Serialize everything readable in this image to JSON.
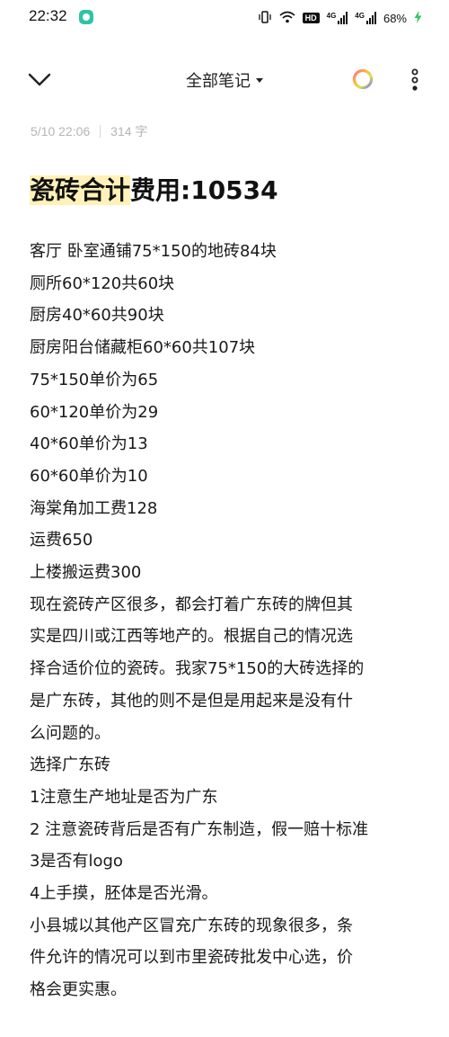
{
  "status_bar": {
    "time": "22:32",
    "hd_label": "HD",
    "signal_label_1": "4G",
    "signal_label_2": "4G",
    "battery": "68%"
  },
  "app_bar": {
    "title": "全部笔记"
  },
  "note": {
    "date": "5/10 22:06",
    "word_count": "314 字",
    "title_highlight": "瓷砖合计",
    "title_rest": "费用:10534",
    "lines": [
      "客厅 卧室通铺75*150的地砖84块",
      "厕所60*120共60块",
      "厨房40*60共90块",
      "厨房阳台储藏柜60*60共107块",
      "75*150单价为65",
      "60*120单价为29",
      "40*60单价为13",
      "60*60单价为10",
      "海棠角加工费128",
      "运费650",
      "上楼搬运费300",
      "现在瓷砖产区很多，都会打着广东砖的牌但其",
      "实是四川或江西等地产的。根据自己的情况选",
      "择合适价位的瓷砖。我家75*150的大砖选择的",
      "是广东砖，其他的则不是但是用起来是没有什",
      "么问题的。",
      "选择广东砖",
      "1注意生产地址是否为广东",
      "2 注意瓷砖背后是否有广东制造，假一赔十标准",
      "3是否有logo",
      "4上手摸，胚体是否光滑。",
      "小县城以其他产区冒充广东砖的现象很多，条",
      "件允许的情况可以到市里瓷砖批发中心选，价",
      "格会更实惠。"
    ]
  },
  "icons": {
    "back": "chevron-down-icon",
    "theme": "color-ring-icon",
    "more": "more-vertical-icon"
  },
  "colors": {
    "highlight": "#fff1b8",
    "meta_text": "#b5b5b5",
    "app_badge": "#2ec4a6"
  }
}
